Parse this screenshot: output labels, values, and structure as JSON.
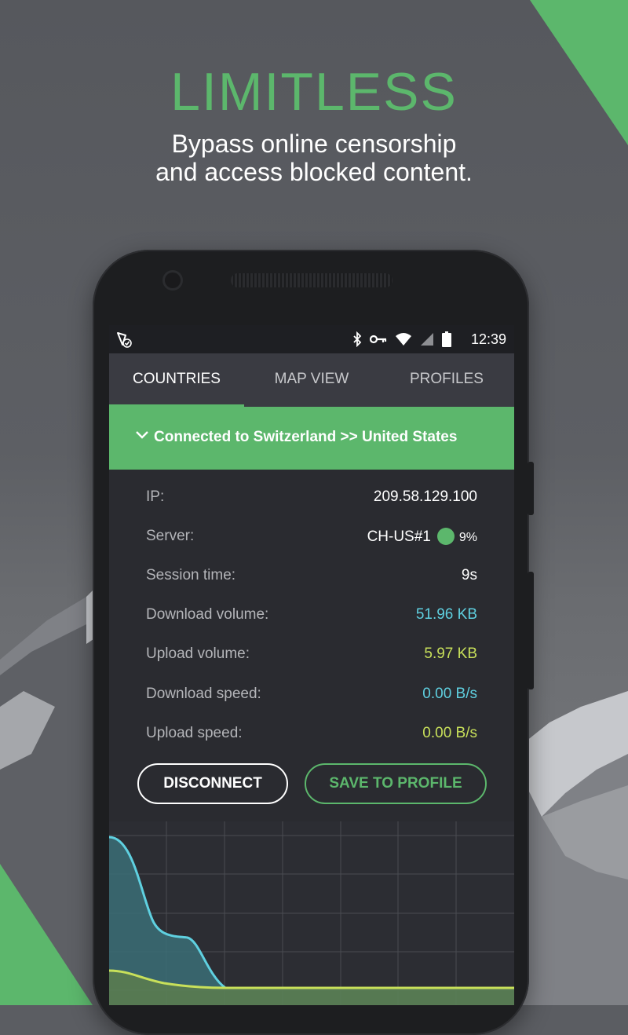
{
  "promo": {
    "title": "LIMITLESS",
    "subtitle_line1": "Bypass online censorship",
    "subtitle_line2": "and access blocked content."
  },
  "status_bar": {
    "time": "12:39",
    "icons": [
      "vpn-app-icon",
      "bluetooth-icon",
      "key-icon",
      "wifi-icon",
      "signal-icon",
      "battery-icon"
    ]
  },
  "tabs": [
    {
      "label": "COUNTRIES",
      "active": true
    },
    {
      "label": "MAP VIEW",
      "active": false
    },
    {
      "label": "PROFILES",
      "active": false
    }
  ],
  "connection": {
    "banner_text": "Connected to Switzerland >> United States",
    "rows": [
      {
        "label": "IP:",
        "value": "209.58.129.100"
      },
      {
        "label": "Server:",
        "value": "CH-US#1",
        "load": "9%"
      },
      {
        "label": "Session time:",
        "value": "9s"
      },
      {
        "label": "Download volume:",
        "value": "51.96 KB"
      },
      {
        "label": "Upload volume:",
        "value": "5.97 KB"
      },
      {
        "label": "Download speed:",
        "value": "0.00 B/s"
      },
      {
        "label": "Upload speed:",
        "value": "0.00 B/s"
      }
    ]
  },
  "buttons": {
    "disconnect": "DISCONNECT",
    "save_to_profile": "SAVE TO PROFILE"
  },
  "colors": {
    "accent_green": "#5cb76c",
    "download_cyan": "#5fd0e0",
    "upload_lime": "#c8e05a"
  }
}
